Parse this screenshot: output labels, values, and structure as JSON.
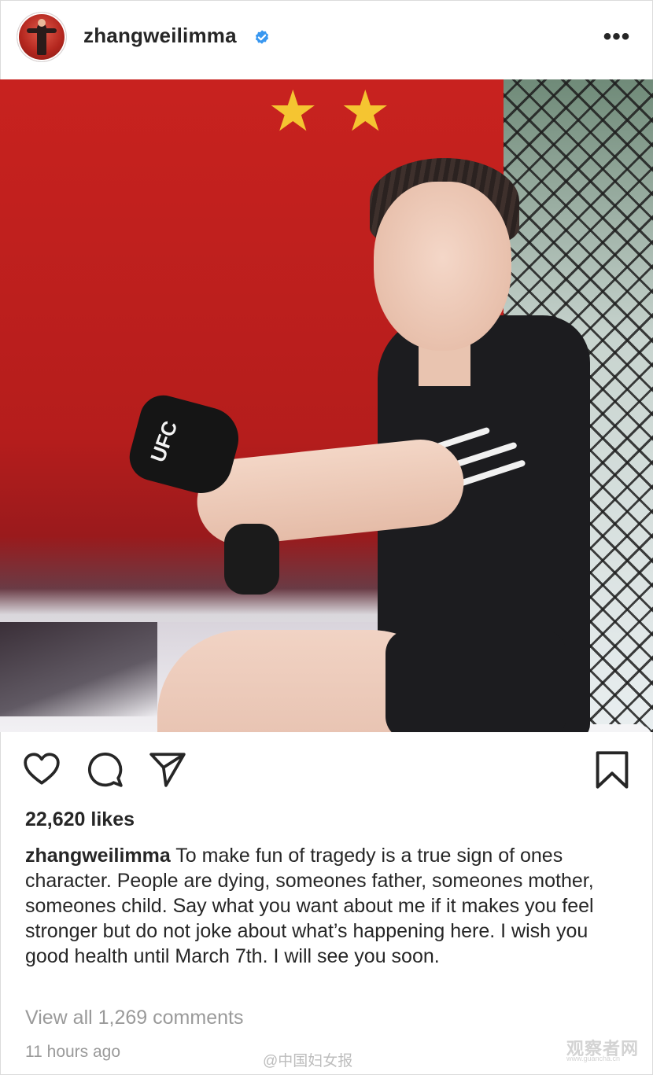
{
  "post": {
    "username": "zhangweilimma",
    "verified_icon": "verified-badge-icon",
    "more_icon": "more-options-icon",
    "more_label": "•••",
    "likes": "22,620 likes",
    "caption_user": "zhangweilimma",
    "caption_text": "To make fun of tragedy is a true sign of ones character. People are dying, someones father, someones mother, someones child. Say what you want about me if it makes you feel stronger but do not joke about what’s happening here. I wish you good health until March 7th. I will see you soon.",
    "view_comments": "View all 1,269 comments",
    "timestamp": "11 hours ago",
    "photo_gloves_text": "UFC"
  },
  "actions": {
    "like_icon": "heart-icon",
    "comment_icon": "comment-icon",
    "share_icon": "send-icon",
    "save_icon": "bookmark-icon"
  },
  "watermarks": {
    "weibo": "@中国妇女报",
    "site_name": "观察者网",
    "site_url": "www.guancha.cn"
  },
  "colors": {
    "verified": "#3897f0",
    "text": "#262626",
    "muted": "#9a9a9a",
    "border": "#dbdbdb"
  }
}
